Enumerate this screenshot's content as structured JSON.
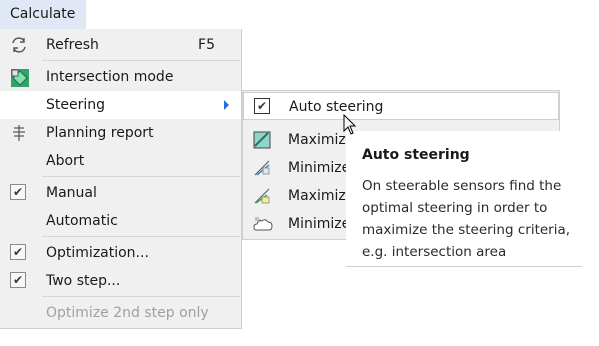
{
  "menubar": {
    "calculate": "Calculate"
  },
  "menu": {
    "refresh": "Refresh",
    "refresh_shortcut": "F5",
    "intersection_mode": "Intersection mode",
    "steering": "Steering",
    "planning_report": "Planning report",
    "abort": "Abort",
    "manual": "Manual",
    "automatic": "Automatic",
    "optimization": "Optimization...",
    "two_step": "Two step...",
    "optimize_2nd_step_only": "Optimize 2nd step only"
  },
  "submenu": {
    "auto_steering": "Auto steering",
    "maximize_1": "Maximiz",
    "minimize_1": "Minimize",
    "maximize_2": "Maximiz",
    "minimize_2": "Minimize"
  },
  "tooltip": {
    "title": "Auto steering",
    "body": "On steerable sensors find the optimal steering in order to maximize the steering criteria, e.g. intersection area"
  },
  "colors": {
    "menubar_active": "#dfe8f4",
    "menu_bg": "#f0f0f0",
    "submenu_arrow": "#2a6fd6"
  }
}
